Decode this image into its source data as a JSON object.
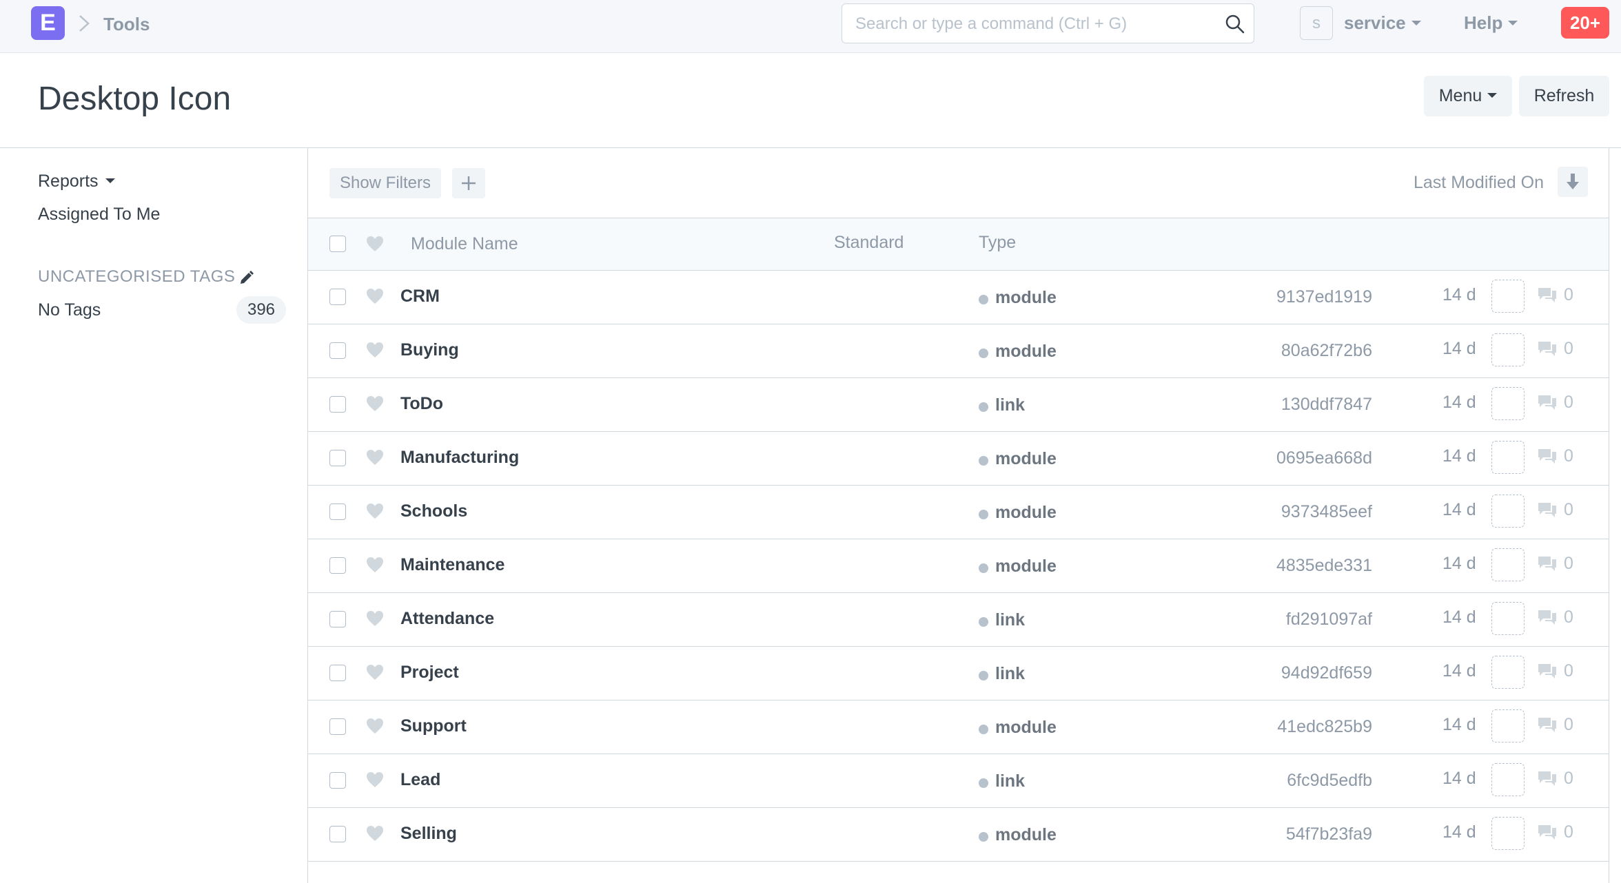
{
  "navbar": {
    "logo_letter": "E",
    "breadcrumb": "Tools",
    "search_placeholder": "Search or type a command (Ctrl + G)",
    "avatar_letter": "s",
    "user_menu": "service",
    "help_menu": "Help",
    "notifications": "20+"
  },
  "page": {
    "title": "Desktop Icon",
    "menu_button": "Menu",
    "refresh_button": "Refresh"
  },
  "sidebar": {
    "reports": "Reports",
    "assigned_to_me": "Assigned To Me",
    "tags_heading": "UNCATEGORISED TAGS",
    "no_tags_label": "No Tags",
    "no_tags_count": "396"
  },
  "list": {
    "show_filters": "Show Filters",
    "sort_label": "Last Modified On",
    "columns": {
      "module_name": "Module Name",
      "standard": "Standard",
      "type": "Type"
    },
    "rows": [
      {
        "name": "CRM",
        "type": "module",
        "id": "9137ed1919",
        "modified": "14 d",
        "comments": "0"
      },
      {
        "name": "Buying",
        "type": "module",
        "id": "80a62f72b6",
        "modified": "14 d",
        "comments": "0"
      },
      {
        "name": "ToDo",
        "type": "link",
        "id": "130ddf7847",
        "modified": "14 d",
        "comments": "0"
      },
      {
        "name": "Manufacturing",
        "type": "module",
        "id": "0695ea668d",
        "modified": "14 d",
        "comments": "0"
      },
      {
        "name": "Schools",
        "type": "module",
        "id": "9373485eef",
        "modified": "14 d",
        "comments": "0"
      },
      {
        "name": "Maintenance",
        "type": "module",
        "id": "4835ede331",
        "modified": "14 d",
        "comments": "0"
      },
      {
        "name": "Attendance",
        "type": "link",
        "id": "fd291097af",
        "modified": "14 d",
        "comments": "0"
      },
      {
        "name": "Project",
        "type": "link",
        "id": "94d92df659",
        "modified": "14 d",
        "comments": "0"
      },
      {
        "name": "Support",
        "type": "module",
        "id": "41edc825b9",
        "modified": "14 d",
        "comments": "0"
      },
      {
        "name": "Lead",
        "type": "link",
        "id": "6fc9d5edfb",
        "modified": "14 d",
        "comments": "0"
      },
      {
        "name": "Selling",
        "type": "module",
        "id": "54f7b23fa9",
        "modified": "14 d",
        "comments": "0"
      }
    ]
  },
  "colors": {
    "logo": "#7b6ef0",
    "notification": "#ff5858",
    "muted_text": "#8d99a6",
    "border": "#d1d8dd"
  }
}
